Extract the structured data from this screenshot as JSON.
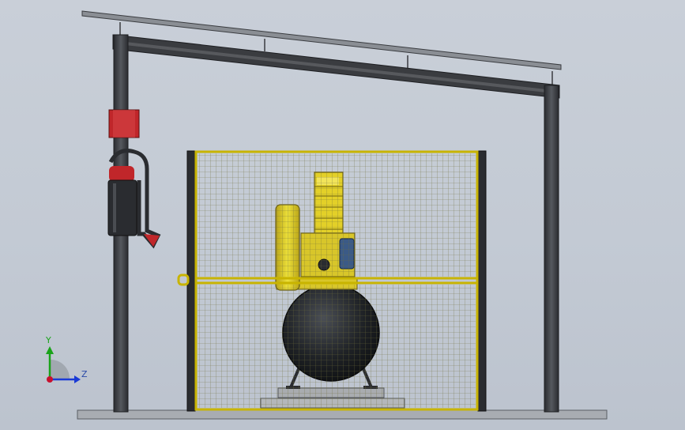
{
  "viewport": {
    "background": "#c6ccd6"
  },
  "triad": {
    "y_label": "Y",
    "z_label": "Z",
    "y_color": "#1aa31a",
    "z_color": "#1a3ad6",
    "origin_color": "#c8102e"
  },
  "colors": {
    "frame": "#3a3c40",
    "cage": "#c8b400",
    "mesh": "#6f6e3c",
    "compressor_yellow": "#e3d028",
    "tank": "#1c1f23",
    "motor_blue": "#3b5a86",
    "extinguisher_red": "#c0262a",
    "floor": "#a8acb2"
  }
}
